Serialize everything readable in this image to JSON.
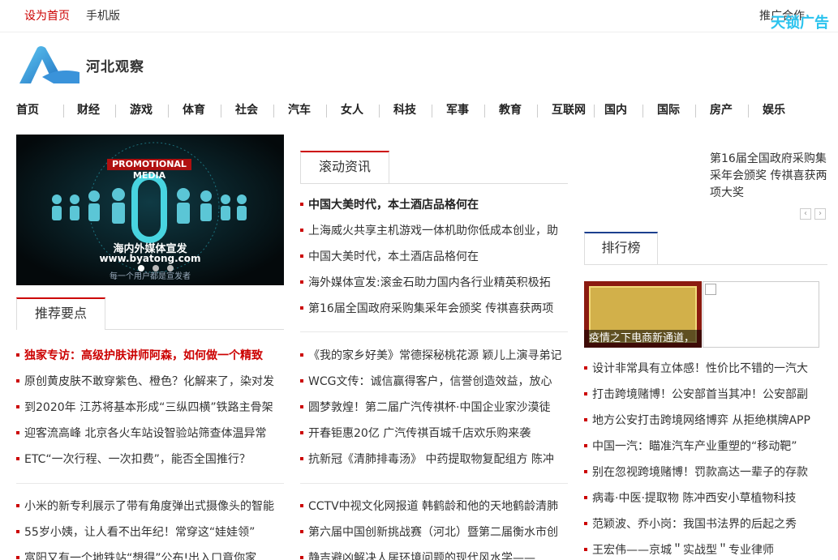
{
  "topbar": {
    "home": "设为首页",
    "mobile": "手机版",
    "coop": "推广合作",
    "ad": "天锁广告"
  },
  "brand": {
    "name": "河北观察"
  },
  "nav": [
    "首页",
    "财经",
    "游戏",
    "体育",
    "社会",
    "汽车",
    "女人",
    "科技",
    "军事",
    "教育",
    "互联网",
    "国内",
    "国际",
    "房产",
    "娱乐"
  ],
  "banner": {
    "top_text": "PROMOTIONAL MEDIA",
    "title": "海内外媒体宣发",
    "url": "www.byatong.com",
    "sub": "每一个用户都是宣发者"
  },
  "recommend": {
    "title": "推荐要点",
    "list1": [
      "独家专访：高级护肤讲师阿森，如何做一个精致",
      "原创黄皮肤不敢穿紫色、橙色？化解来了，染对发",
      "到2020年 江苏将基本形成“三纵四横”铁路主骨架",
      "迎客流高峰 北京各火车站设智验站筛查体温异常",
      "ETC“一次行程、一次扣费”，能否全国推行？"
    ],
    "list2": [
      "小米的新专利展示了带有角度弹出式摄像头的智能",
      "55岁小姨，让人看不出年纪！常穿这“娃娃领”",
      "富阳又有一个地铁站“想得”公布!出入口竟你家"
    ]
  },
  "rolling": {
    "title": "滚动资讯",
    "list1": [
      "中国大美时代，本土酒店品格何在",
      "上海威火共享主机游戏一体机助你低成本创业，助",
      "中国大美时代，本土酒店品格何在",
      "海外媒体宣发:滚金石助力国内各行业精英积极拓",
      "第16届全国政府采购集采年会颁奖 传祺喜获两项"
    ],
    "list2": [
      "《我的家乡好美》常德探秘桃花源 颖儿上演寻弟记",
      "WCG文传：诚信赢得客户，信誉创造效益，放心",
      "圆梦敦煌！第二届广汽传祺杯·中国企业家沙漠徒",
      "开春钜惠20亿 广汽传祺百城千店欢乐购来袭",
      "抗新冠《清肺排毒汤》 中药提取物复配组方 陈冲"
    ],
    "list3": [
      "CCTV中视文化网报道 韩鹤龄和他的天地鹤龄清肺",
      "第六届中国创新挑战赛（河北）暨第二届衡水市创",
      "静吉避凶解决人居环境问题的现代风水学——"
    ]
  },
  "side_scroll": {
    "text": "第16届全国政府采购集采年会颁奖 传祺喜获两项大奖"
  },
  "ranking": {
    "title": "排行榜",
    "image_caption": "疫情之下电商新通道，",
    "list": [
      "设计非常具有立体感！性价比不错的一汽大",
      "打击跨境赌博！公安部首当其冲！公安部副",
      "地方公安打击跨境网络博弈 从拒绝棋牌APP",
      "中国一汽：瞄准汽车产业重塑的“移动靶”",
      "别在忽视跨境赌博！罚款高达一辈子的存款",
      "病毒·中医·提取物 陈冲西安小草植物科技",
      "范颖波、乔小岗：我国书法界的后起之秀",
      "王宏伟——京城＂实战型＂专业律师"
    ]
  },
  "colors": {
    "accent_red": "#cc0000",
    "ad_blue": "#2bc3ee",
    "rank_blue": "#1c3f8e"
  }
}
